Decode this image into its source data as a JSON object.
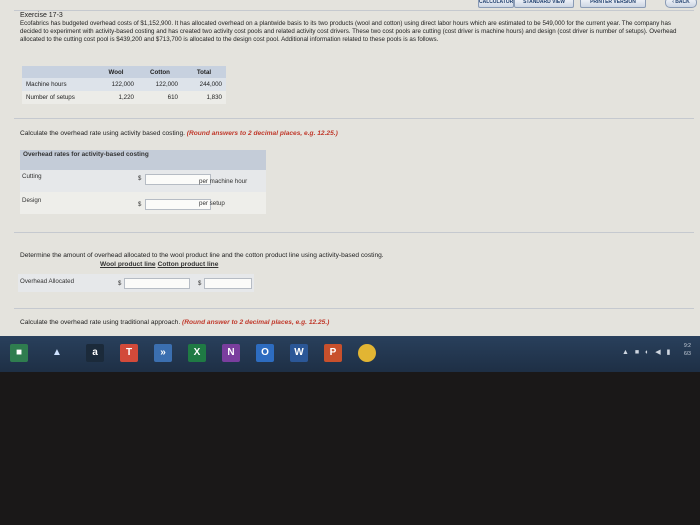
{
  "toolbar": {
    "calculator": "CALCULATOR",
    "standard_view": "STANDARD VIEW",
    "printer_version": "PRINTER VERSION",
    "back": "‹ BACK"
  },
  "exercise": {
    "title": "Exercise 17-3",
    "intro": "Ecofabrics has budgeted overhead costs of $1,152,900. It has allocated overhead on a plantwide basis to its two products (wool and cotton) using direct labor hours which are estimated to be 549,000 for the current year. The company has decided to experiment with activity-based costing and has created two activity cost pools and related activity cost drivers. These two cost pools are cutting (cost driver is machine hours) and design (cost driver is number of setups). Overhead allocated to the cutting cost pool is $439,200 and $713,700 is allocated to the design cost pool. Additional information related to these pools is as follows."
  },
  "info_table": {
    "headers": [
      "",
      "Wool",
      "Cotton",
      "Total"
    ],
    "rows": [
      [
        "Machine hours",
        "122,000",
        "122,000",
        "244,000"
      ],
      [
        "Number of setups",
        "1,220",
        "610",
        "1,830"
      ]
    ]
  },
  "q1": {
    "text": "Calculate the overhead rate using activity based costing.",
    "hint": "(Round answers to 2 decimal places, e.g. 12.25.)"
  },
  "overhead_panel": {
    "header": "Overhead rates for activity-based costing",
    "rows": [
      {
        "label": "Cutting",
        "symbol": "$",
        "value": "",
        "unit": "per machine hour"
      },
      {
        "label": "Design",
        "symbol": "$",
        "value": "",
        "unit": "per setup"
      }
    ]
  },
  "q2": {
    "text": "Determine the amount of overhead allocated to the wool product line and the cotton product line using activity-based costing."
  },
  "allocation": {
    "col_wool": "Wool product line",
    "col_cotton": "Cotton product line",
    "row_label": "Overhead Allocated",
    "symbol": "$",
    "wool_value": "",
    "cotton_value": ""
  },
  "q3": {
    "text": "Calculate the overhead rate using traditional approach.",
    "hint": "(Round answer to 2 decimal places, e.g. 12.25.)"
  },
  "taskbar": {
    "icons": [
      {
        "name": "amazon-icon",
        "glyph": "a",
        "color": "#1b2a3a"
      },
      {
        "name": "todoist-icon",
        "glyph": "T",
        "color": "#d24a3a"
      },
      {
        "name": "forward-icon",
        "glyph": "»",
        "color": "#3b6fb0"
      },
      {
        "name": "excel-icon",
        "glyph": "X",
        "color": "#1f7a44"
      },
      {
        "name": "onenote-icon",
        "glyph": "N",
        "color": "#7a3e9e"
      },
      {
        "name": "outlook-icon",
        "glyph": "O",
        "color": "#2d6cc0"
      },
      {
        "name": "word-icon",
        "glyph": "W",
        "color": "#2b5797"
      },
      {
        "name": "powerpoint-icon",
        "glyph": "P",
        "color": "#c8502c"
      },
      {
        "name": "chrome-icon",
        "glyph": "",
        "color": "#e2b533"
      }
    ],
    "clock_time": "9:2",
    "clock_date": "6/3"
  }
}
